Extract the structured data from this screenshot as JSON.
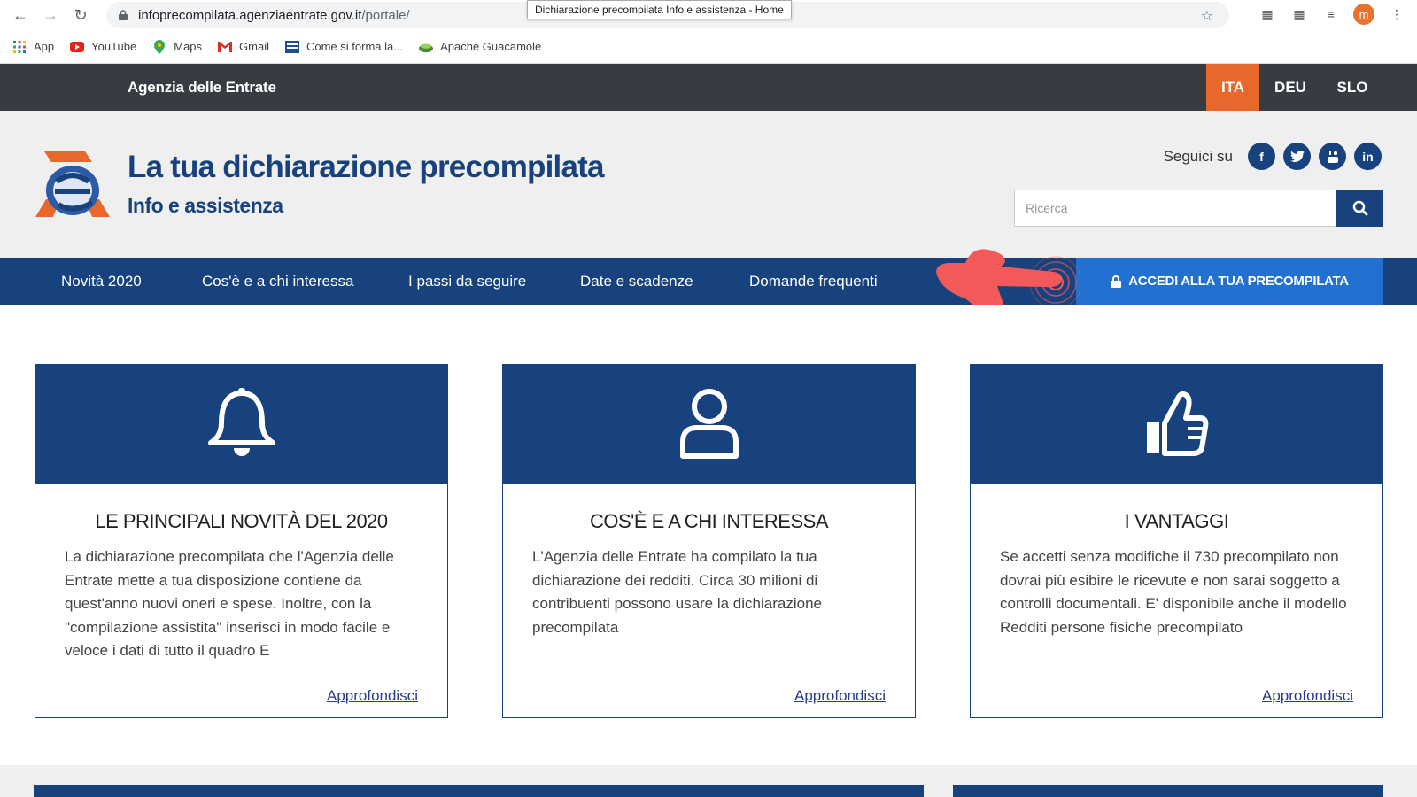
{
  "browser": {
    "url_host": "infoprecompilata.agenziaentrate.gov.it",
    "url_path": "/portale/",
    "tooltip": "Dichiarazione precompilata Info e assistenza - Home",
    "profile_initial": "m",
    "bookmarks": [
      {
        "label": "App"
      },
      {
        "label": "YouTube"
      },
      {
        "label": "Maps"
      },
      {
        "label": "Gmail"
      },
      {
        "label": "Come si forma la..."
      },
      {
        "label": "Apache Guacamole"
      }
    ]
  },
  "topbar": {
    "org_name": "Agenzia delle Entrate",
    "languages": [
      "ITA",
      "DEU",
      "SLO"
    ],
    "active_language": "ITA"
  },
  "header": {
    "title": "La tua dichiarazione precompilata",
    "subtitle": "Info e assistenza",
    "social_label": "Seguici su",
    "search_placeholder": "Ricerca"
  },
  "nav": {
    "items": [
      "Novità 2020",
      "Cos'è e a chi interessa",
      "I passi da seguire",
      "Date e scadenze",
      "Domande frequenti"
    ],
    "login_label": "ACCEDI ALLA TUA PRECOMPILATA"
  },
  "cards": [
    {
      "icon": "bell-icon",
      "title": "LE PRINCIPALI NOVITÀ DEL 2020",
      "text": "La dichiarazione precompilata che l'Agenzia delle Entrate mette a tua disposizione contiene da quest'anno nuovi oneri e spese. Inoltre, con la \"compilazione assistita\" inserisci in modo facile e veloce i dati di tutto il quadro E",
      "link": "Approfondisci"
    },
    {
      "icon": "user-icon",
      "title": "COS'È E A CHI INTERESSA",
      "text": "L'Agenzia delle Entrate ha compilato la tua dichiarazione dei redditi. Circa 30 milioni di contribuenti possono usare la dichiarazione precompilata",
      "link": "Approfondisci"
    },
    {
      "icon": "thumbs-up-icon",
      "title": "I VANTAGGI",
      "text": "Se accetti senza modifiche il 730 precompilato non dovrai più esibire le ricevute e non sarai soggetto a controlli documentali. E' disponibile anche il modello Redditi persone fisiche precompilato",
      "link": "Approfondisci"
    }
  ],
  "colors": {
    "brand_blue": "#17427e",
    "login_blue": "#2271d1",
    "active_lang": "#e8672a",
    "topbar": "#363c41"
  }
}
